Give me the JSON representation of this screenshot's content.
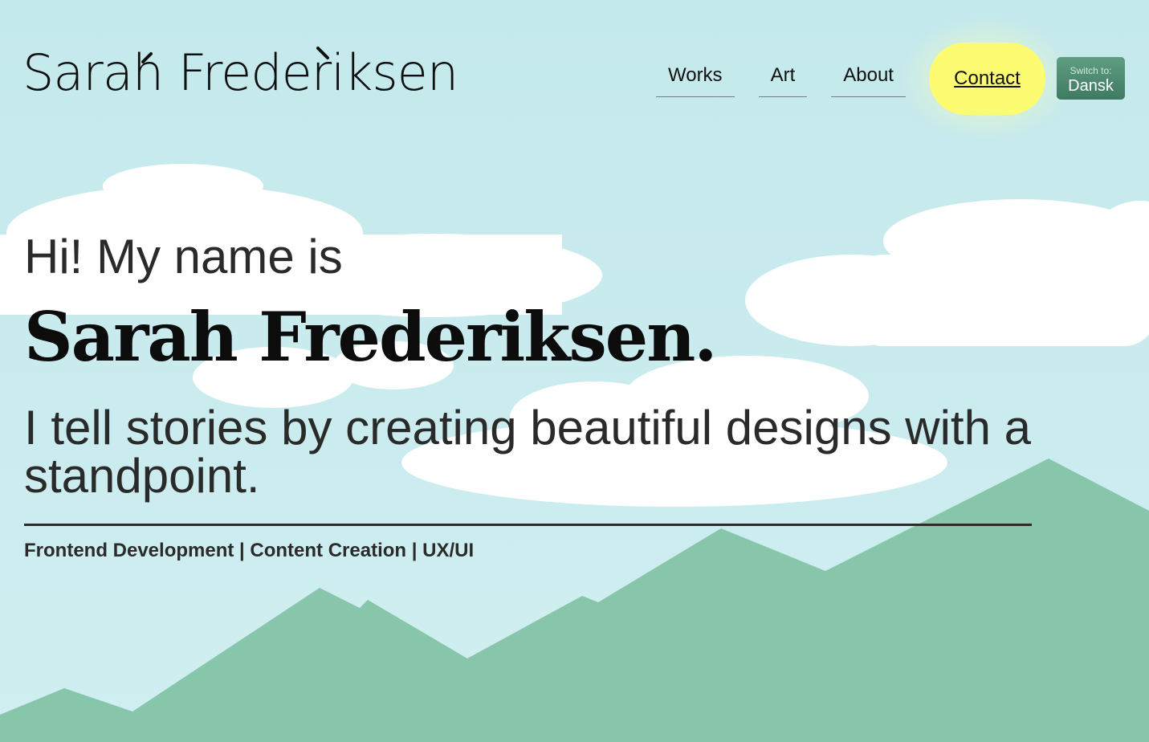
{
  "logo": {
    "text": "Sarah Frederiksen"
  },
  "nav": {
    "items": [
      {
        "label": "Works"
      },
      {
        "label": "Art"
      },
      {
        "label": "About"
      }
    ],
    "contact_label": "Contact"
  },
  "language": {
    "switch_label": "Switch to:",
    "target": "Dansk"
  },
  "hero": {
    "greeting": "Hi! My name is",
    "name": "Sarah Frederiksen.",
    "tagline": "I tell stories by creating beautiful designs with a standpoint.",
    "skills": "Frontend Development | Content Creation | UX/UI"
  },
  "colors": {
    "sky": "#c4e9ec",
    "mountain": "#88c6ab",
    "cloud": "#ffffff",
    "contact_button": "#fdfb72",
    "language_button": "#4f8c72",
    "text": "#2b2b2b"
  }
}
